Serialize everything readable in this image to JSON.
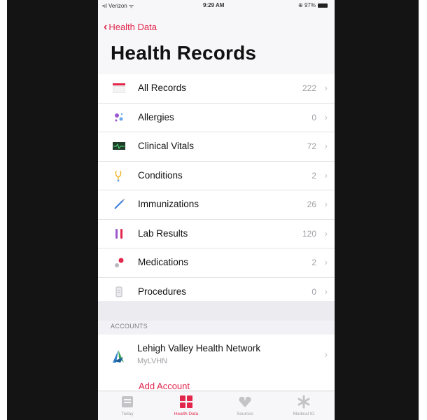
{
  "status_bar": {
    "carrier": "Verizon",
    "time": "9:29 AM",
    "battery": "97%"
  },
  "nav": {
    "back_label": "Health Data",
    "title": "Health Records"
  },
  "records": [
    {
      "label": "All Records",
      "count": "222",
      "icon": "all-records-icon"
    },
    {
      "label": "Allergies",
      "count": "0",
      "icon": "allergies-icon"
    },
    {
      "label": "Clinical Vitals",
      "count": "72",
      "icon": "clinical-vitals-icon"
    },
    {
      "label": "Conditions",
      "count": "2",
      "icon": "conditions-icon"
    },
    {
      "label": "Immunizations",
      "count": "26",
      "icon": "immunizations-icon"
    },
    {
      "label": "Lab Results",
      "count": "120",
      "icon": "lab-results-icon"
    },
    {
      "label": "Medications",
      "count": "2",
      "icon": "medications-icon"
    },
    {
      "label": "Procedures",
      "count": "0",
      "icon": "procedures-icon"
    }
  ],
  "accounts": {
    "header": "ACCOUNTS",
    "items": [
      {
        "name": "Lehigh Valley Health Network",
        "subtitle": "MyLVHN"
      }
    ],
    "add_label": "Add Account"
  },
  "tabbar": [
    {
      "label": "Today",
      "icon": "today-icon",
      "active": false
    },
    {
      "label": "Health Data",
      "icon": "health-data-icon",
      "active": true
    },
    {
      "label": "Sources",
      "icon": "sources-icon",
      "active": false
    },
    {
      "label": "Medical ID",
      "icon": "medical-id-icon",
      "active": false
    }
  ],
  "colors": {
    "accent": "#e2264c",
    "background": "#f2f2f6"
  }
}
